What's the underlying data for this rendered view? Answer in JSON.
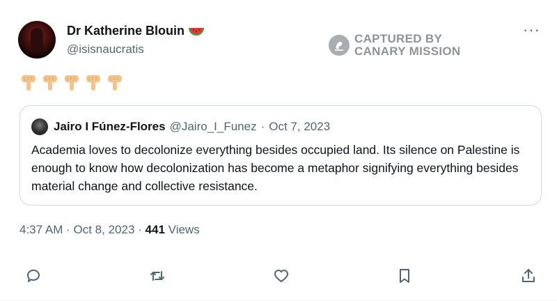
{
  "tweet": {
    "author": {
      "display_name": "Dr Katherine Blouin",
      "name_emoji": "watermelon-icon",
      "handle": "@isisnaucratis"
    },
    "body_emojis": [
      "backhand-index-pointing-down",
      "backhand-index-pointing-down",
      "backhand-index-pointing-down",
      "backhand-index-pointing-down",
      "backhand-index-pointing-down"
    ],
    "more_label": "···",
    "quoted": {
      "display_name": "Jairo I Fúnez-Flores",
      "handle": "@Jairo_I_Funez",
      "separator": "·",
      "date": "Oct 7, 2023",
      "text": "Academia loves to decolonize everything besides occupied land. Its silence on Palestine is enough to know how decolonization has become a metaphor signifying everything besides material change and collective resistance."
    },
    "meta": {
      "time": "4:37 AM",
      "separator": "·",
      "date": "Oct 8, 2023",
      "separator2": "·",
      "views_count": "441",
      "views_label": "Views"
    }
  },
  "watermark": {
    "line1": "CAPTURED BY",
    "line2": "CANARY MISSION"
  },
  "actions": [
    "reply-icon",
    "retweet-icon",
    "like-icon",
    "bookmark-icon",
    "share-icon"
  ],
  "colors": {
    "text": "#0f1419",
    "secondary": "#536471",
    "border": "#cfd9de",
    "watermark": "#8e9398"
  }
}
